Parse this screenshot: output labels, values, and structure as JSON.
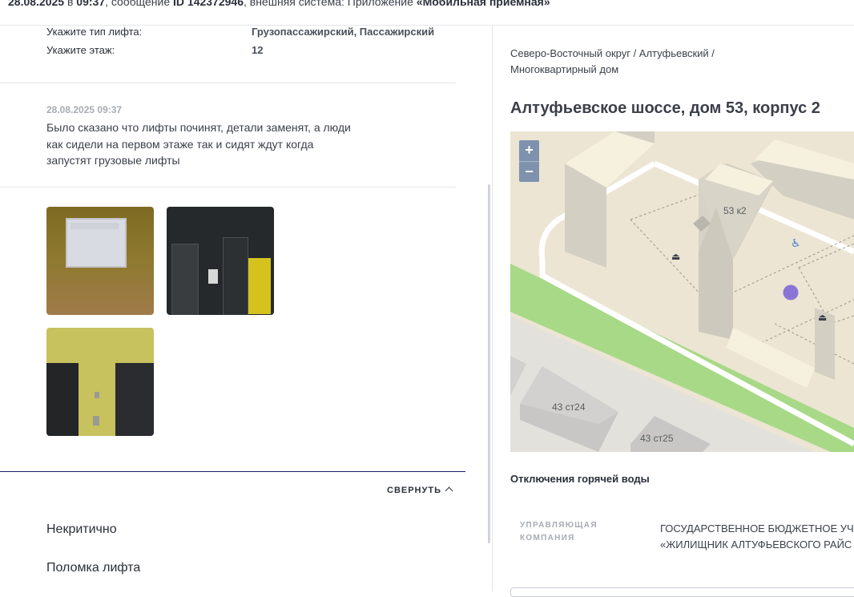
{
  "header": {
    "date": "28.08.2025",
    "in_word": " в ",
    "time": "09:37",
    "message_word": ", сообщение ",
    "message_id": "ID 142372946",
    "system_text": ", внешняя система: Приложение ",
    "system_name": "«Мобильная приемная»"
  },
  "properties": [
    {
      "label": "Укажите тип лифта:",
      "value": "Грузопассажирский, Пассажирский"
    },
    {
      "label": "Укажите этаж:",
      "value": "12"
    }
  ],
  "message": {
    "date": "28.08.2025 09:37",
    "text": "Было сказано что лифты починят, детали заменят, а люди как сидели на первом этаже так и сидят ждут когда запустят грузовые лифты"
  },
  "collapse_label": "СВЕРНУТЬ",
  "bottom_items": [
    "Некритично",
    "Поломка лифта"
  ],
  "right": {
    "breadcrumb": "Северо-Восточный округ / Алтуфьевский / Многоквартирный дом",
    "address": "Алтуфьевское шоссе, дом 53, корпус 2",
    "map": {
      "zoom_in": "+",
      "zoom_out": "−",
      "labels": [
        "53 к2",
        "43 ст24",
        "43 ст25"
      ],
      "marker_color": "#8a74d6"
    },
    "hot_water": "Отключения горячей воды",
    "management_label": "УПРАВЛЯЮЩАЯ КОМПАНИЯ",
    "management_value_1": "ГОСУДАРСТВЕННОЕ БЮДЖЕТНОЕ УЧ",
    "management_value_2": "«ЖИЛИЩНИК АЛТУФЬЕВСКОГО РАЙС"
  }
}
